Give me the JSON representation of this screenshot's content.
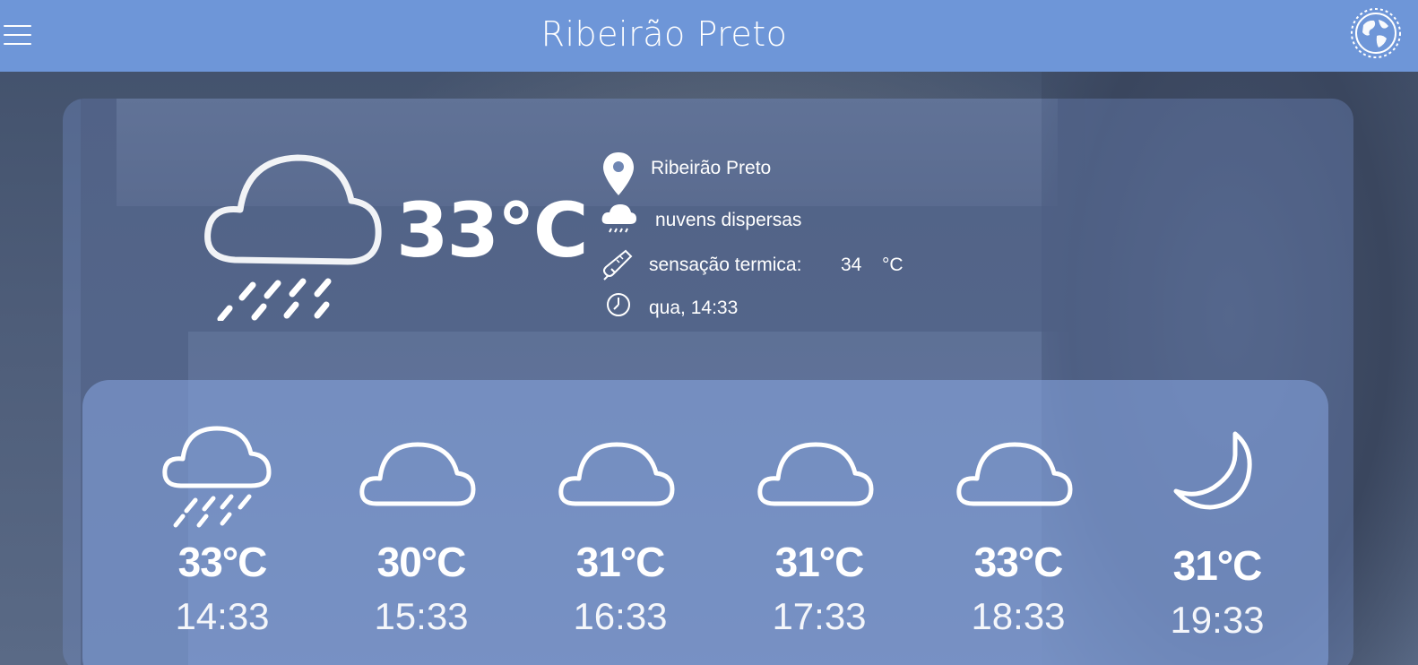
{
  "header": {
    "title": "Ribeirão Preto",
    "menu_icon": "hamburger-menu-icon",
    "globe_icon": "globe-icon"
  },
  "current": {
    "icon": "cloud-rain-icon",
    "temperature": "33°C",
    "location": "Ribeirão Preto",
    "description": "nuvens dispersas",
    "feels_like_label": "sensação termica:",
    "feels_like_value": "34",
    "feels_like_unit": "°C",
    "datetime": "qua, 14:33"
  },
  "forecast": [
    {
      "temp": "33°C",
      "time": "14:33",
      "icon": "cloud-rain-icon"
    },
    {
      "temp": "30°C",
      "time": "15:33",
      "icon": "cloud-icon"
    },
    {
      "temp": "31°C",
      "time": "16:33",
      "icon": "cloud-icon"
    },
    {
      "temp": "31°C",
      "time": "17:33",
      "icon": "cloud-icon"
    },
    {
      "temp": "33°C",
      "time": "18:33",
      "icon": "cloud-icon"
    },
    {
      "temp": "31°C",
      "time": "19:33",
      "icon": "moon-icon"
    }
  ],
  "colors": {
    "topbar": "#6e96d8",
    "card": "#87a5e1",
    "text": "#ffffff"
  }
}
